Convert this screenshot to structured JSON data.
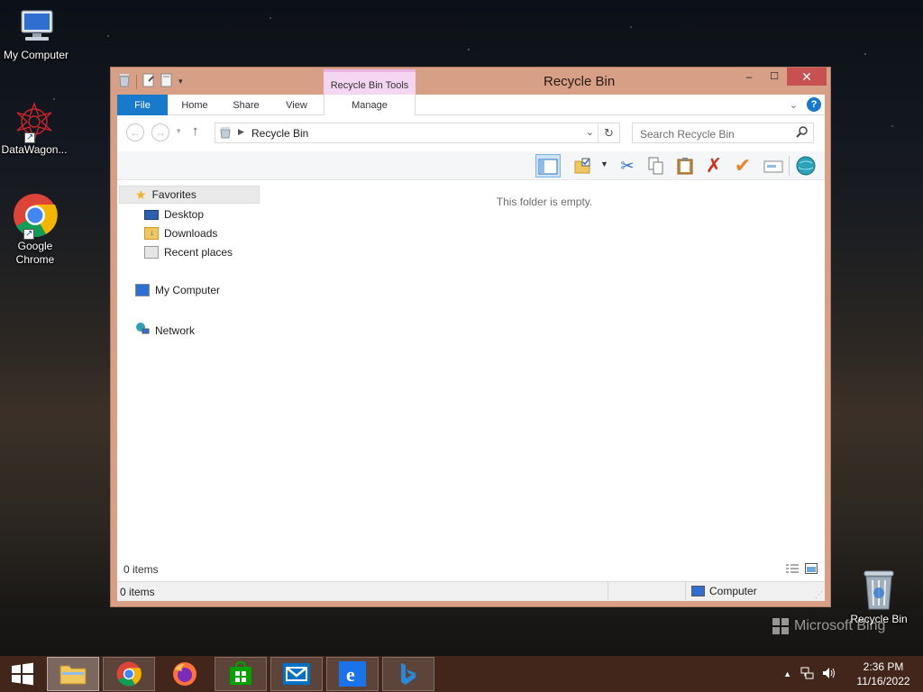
{
  "desktop": {
    "icons": [
      {
        "label": "My Computer",
        "icon": "computer-icon"
      },
      {
        "label": "DataWagon...",
        "icon": "datawagon-icon"
      },
      {
        "label": "Google Chrome",
        "icon": "chrome-icon"
      },
      {
        "label": "Recycle Bin",
        "icon": "recycle-bin-icon"
      }
    ],
    "watermark": "Microsoft Bing"
  },
  "window": {
    "title": "Recycle Bin",
    "context_tab": "Recycle Bin Tools",
    "controls": {
      "minimize": "–",
      "maximize": "☐",
      "close": "✕"
    },
    "ribbon_tabs": [
      "File",
      "Home",
      "Share",
      "View",
      "Manage"
    ],
    "address": {
      "path": "Recycle Bin"
    },
    "search": {
      "placeholder": "Search Recycle Bin"
    },
    "navigation": {
      "favorites_header": "Favorites",
      "favorites": [
        "Desktop",
        "Downloads",
        "Recent places"
      ],
      "computer": "My Computer",
      "network": "Network"
    },
    "content": {
      "empty_message": "This folder is empty."
    },
    "items_count": "0 items",
    "status": {
      "left": "0 items",
      "zone": "Computer"
    }
  },
  "taskbar": {
    "apps": [
      "start-button",
      "file-explorer",
      "chrome",
      "firefox",
      "store",
      "mail",
      "internet-explorer",
      "bing"
    ],
    "clock": {
      "time": "2:36 PM",
      "date": "11/16/2022"
    }
  },
  "colors": {
    "window_frame": "#d69f86",
    "close_button": "#c75050",
    "file_tab": "#1979ca",
    "context_tab": "#f5d6f2",
    "taskbar": "#46281c"
  }
}
